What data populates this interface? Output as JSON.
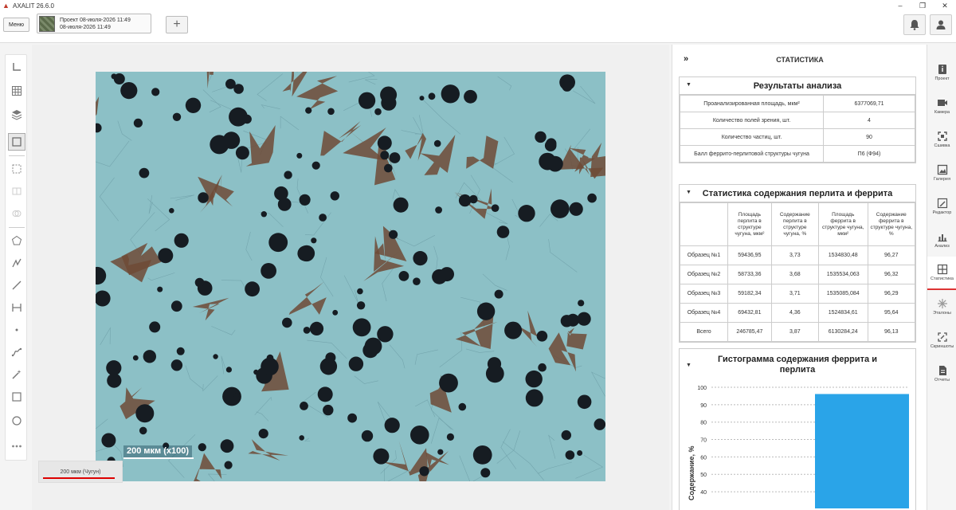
{
  "app": {
    "title": "AXALIT 26.6.0"
  },
  "toolbar": {
    "menu_label": "Меню",
    "project_line1": "Проект 08-июля-2026 11:49",
    "project_line2": "08-июля-2026 11:49",
    "add_label": "+"
  },
  "viewport": {
    "scale_label": "200 мкм (x100)",
    "calibration_label": "200 мкм (Чугун)"
  },
  "panel": {
    "collapse_label": "»",
    "title": "СТАТИСТИКА",
    "analysis": {
      "title": "Результаты анализа",
      "rows": [
        {
          "label": "Проанализированная площадь, мкм²",
          "value": "6377069,71"
        },
        {
          "label": "Количество полей зрения, шт.",
          "value": "4"
        },
        {
          "label": "Количество частиц, шт.",
          "value": "90"
        },
        {
          "label": "Балл феррито-перлитовой структуры чугуна",
          "value": "П6 (Ф94)"
        }
      ]
    },
    "pearlite": {
      "title": "Статистика содержания перлита и феррита",
      "headers": [
        "",
        "Площадь перлита в структуре чугуна, мкм²",
        "Содержание перлита в структуре чугуна, %",
        "Площадь феррита в структуре чугуна, мкм²",
        "Содержание феррита в структуре чугуна, %"
      ],
      "rows": [
        [
          "Образец №1",
          "59436,95",
          "3,73",
          "1534830,48",
          "96,27"
        ],
        [
          "Образец №2",
          "58733,36",
          "3,68",
          "1535534,063",
          "96,32"
        ],
        [
          "Образец №3",
          "59182,34",
          "3,71",
          "1535085,084",
          "96,29"
        ],
        [
          "Образец №4",
          "69432,81",
          "4,36",
          "1524834,61",
          "95,64"
        ],
        [
          "Всего",
          "246785,47",
          "3,87",
          "6130284,24",
          "96,13"
        ]
      ]
    },
    "histogram": {
      "title": "Гистограмма содержания феррита и перлита"
    }
  },
  "chart_data": {
    "type": "bar",
    "title": "Гистограмма содержания феррита и перлита",
    "ylabel": "Содержание, %",
    "xlabel": "",
    "ylim": [
      35,
      100
    ],
    "yticks": [
      "100",
      "90",
      "80",
      "70",
      "60",
      "50",
      "40"
    ],
    "grid": true,
    "series": [
      {
        "values": [
          96.13
        ]
      }
    ]
  },
  "rail": {
    "items": [
      {
        "label": "Проект",
        "icon": "info-icon"
      },
      {
        "label": "Камера",
        "icon": "camera-icon"
      },
      {
        "label": "Сшивка",
        "icon": "stitch-icon"
      },
      {
        "label": "Галерея",
        "icon": "gallery-icon"
      },
      {
        "label": "Редактор",
        "icon": "editor-icon"
      },
      {
        "label": "Анализ",
        "icon": "analysis-icon"
      },
      {
        "label": "Статистика",
        "icon": "statistics-icon"
      },
      {
        "label": "Эталоны",
        "icon": "reference-icon"
      },
      {
        "label": "Скриншоты",
        "icon": "screenshot-icon"
      },
      {
        "label": "Отчеты",
        "icon": "reports-icon"
      }
    ]
  },
  "colors": {
    "accent": "#2aa4e8",
    "active_tab": "#dd3333",
    "micro_bg": "#8cc0c6"
  }
}
